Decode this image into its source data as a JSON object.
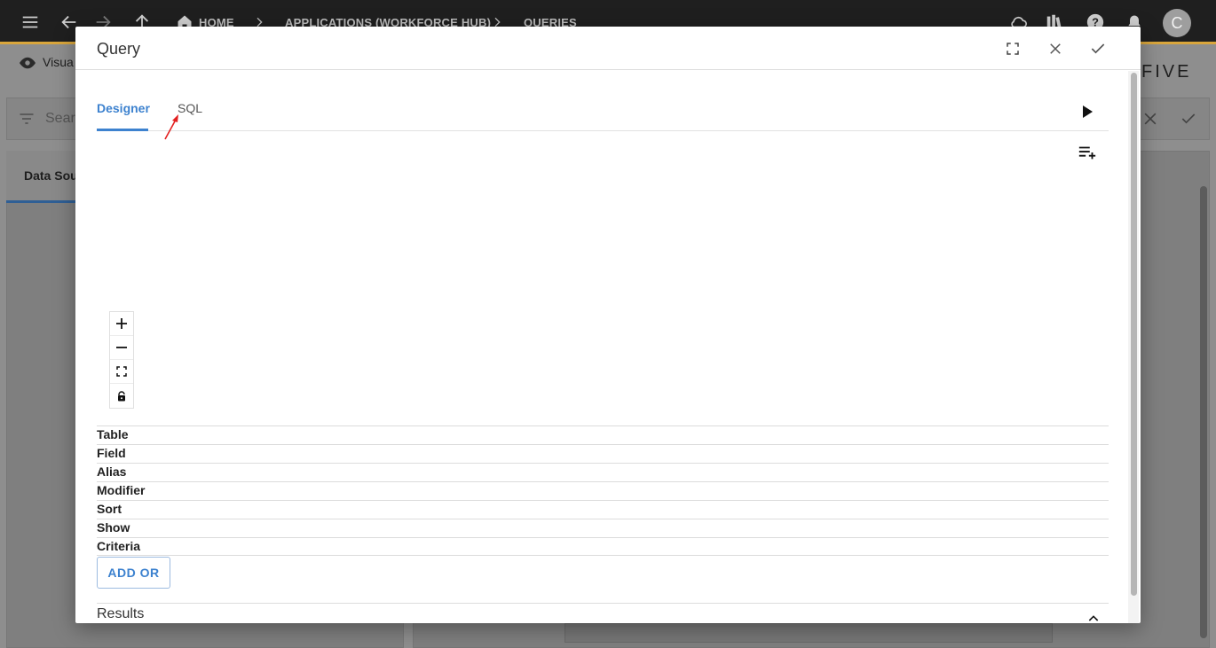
{
  "topbar": {
    "breadcrumbs": [
      "HOME",
      "APPLICATIONS (WORKFORCE HUB)",
      "QUERIES"
    ],
    "avatar_initial": "C"
  },
  "background": {
    "view_label": "Visua",
    "search_placeholder": "Sear",
    "tab_label": "Data Sou",
    "brand": "FIVE"
  },
  "modal": {
    "title": "Query",
    "tabs": [
      {
        "label": "Designer",
        "active": true
      },
      {
        "label": "SQL",
        "active": false
      }
    ],
    "grid_rows": [
      "Table",
      "Field",
      "Alias",
      "Modifier",
      "Sort",
      "Show",
      "Criteria"
    ],
    "add_or_label": "ADD OR",
    "results_label": "Results"
  },
  "colors": {
    "accent_blue": "#3d82cf",
    "topbar": "#1f1f1f",
    "topbar_accent": "#d9a63c",
    "annotation_arrow": "#e32020"
  },
  "icons": [
    "menu-icon",
    "back-icon",
    "forward-icon",
    "up-icon",
    "home-icon",
    "cloud-sync-icon",
    "library-icon",
    "help-icon",
    "bell-icon",
    "fullscreen-icon",
    "close-icon",
    "check-icon",
    "play-icon",
    "playlist-add-icon",
    "zoom-in-icon",
    "zoom-out-icon",
    "fit-icon",
    "lock-icon",
    "chevron-up-icon"
  ]
}
